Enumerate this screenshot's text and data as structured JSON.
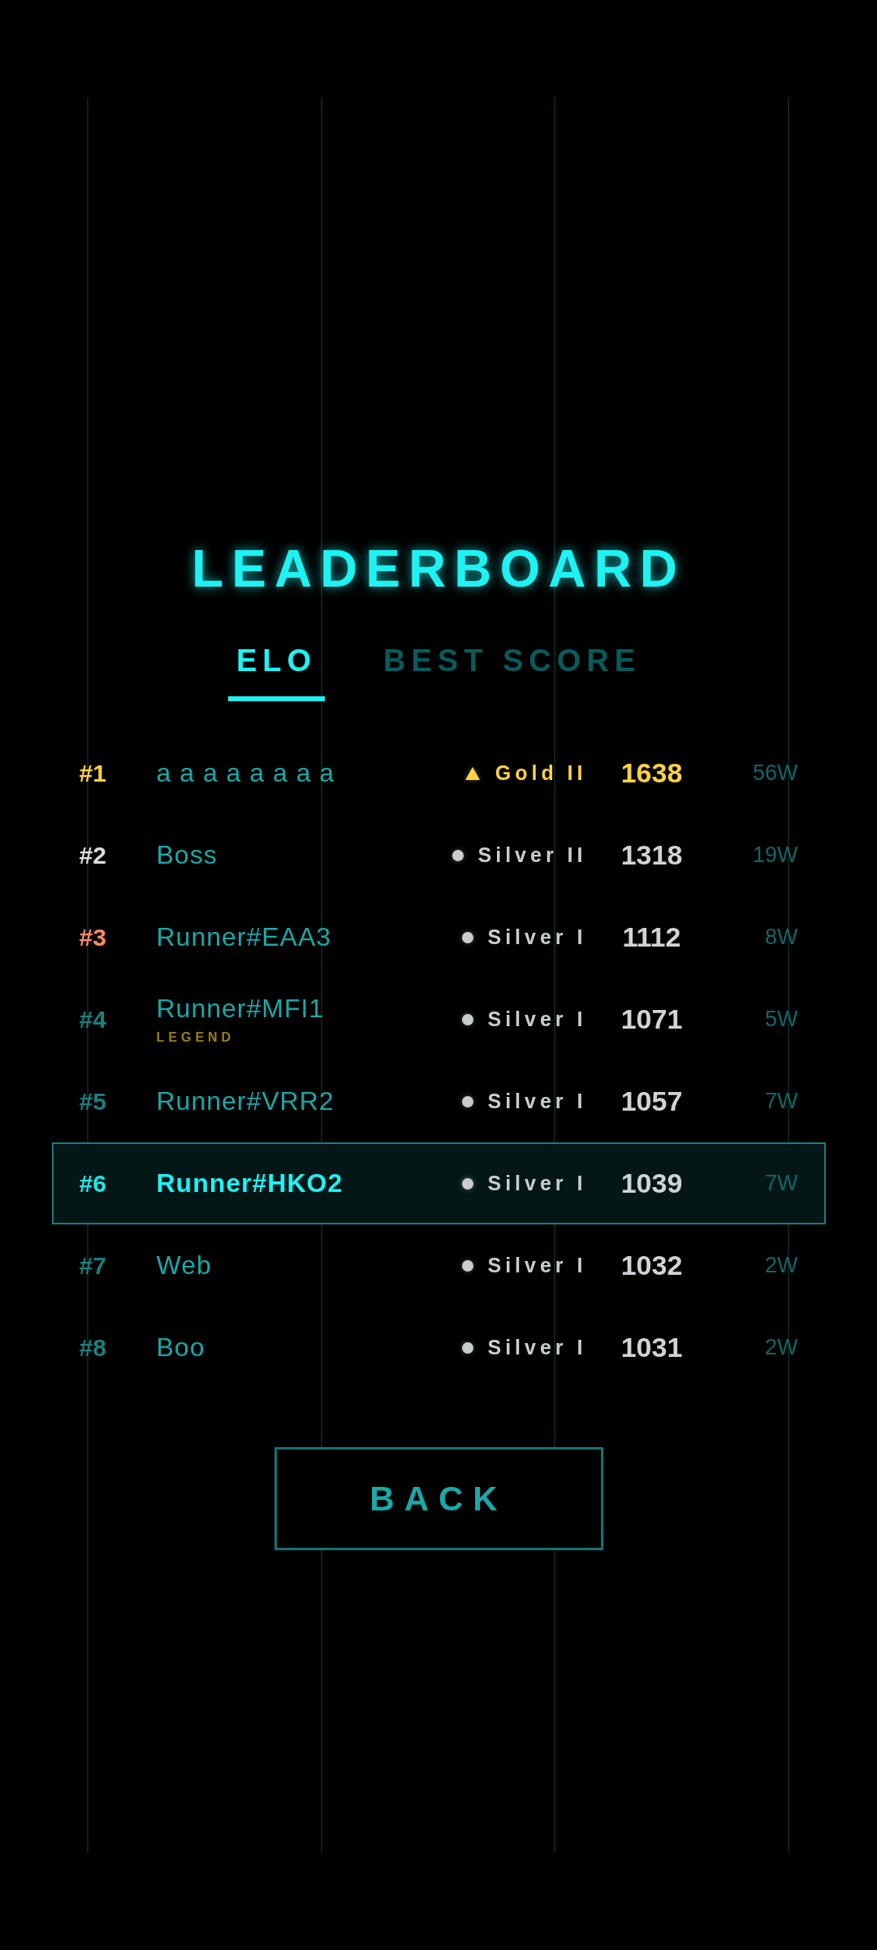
{
  "title": "LEADERBOARD",
  "tabs": [
    {
      "label": "ELO",
      "selected": true
    },
    {
      "label": "BEST SCORE",
      "selected": false
    }
  ],
  "rows": [
    {
      "rank": "#1",
      "color": "#ffd23f",
      "name": "a a a a a a a a",
      "tier": {
        "kind": "triangle",
        "label": "Gold II",
        "color": "#ffd23f"
      },
      "elo": "1638",
      "wins": "56W",
      "selected": false
    },
    {
      "rank": "#2",
      "color": "#d8dde0",
      "name": "Boss",
      "tier": {
        "kind": "dot",
        "label": "Silver II",
        "color": "#c8cdd0"
      },
      "elo": "1318",
      "wins": "19W",
      "selected": false
    },
    {
      "rank": "#3",
      "color": "#ff8a6a",
      "name": "Runner#EAA3",
      "tier": {
        "kind": "dot",
        "label": "Silver I",
        "color": "#c8cdd0"
      },
      "elo": "1112",
      "wins": "8W",
      "selected": false
    },
    {
      "rank": "#4",
      "color": "#1a7f7f",
      "name": "Runner#MFI1",
      "badge": "LEGEND",
      "tier": {
        "kind": "dot",
        "label": "Silver I",
        "color": "#c8cdd0"
      },
      "elo": "1071",
      "wins": "5W",
      "selected": false
    },
    {
      "rank": "#5",
      "color": "#1a7f7f",
      "name": "Runner#VRR2",
      "tier": {
        "kind": "dot",
        "label": "Silver I",
        "color": "#c8cdd0"
      },
      "elo": "1057",
      "wins": "7W",
      "selected": false
    },
    {
      "rank": "#6",
      "color": "#1ee8e8",
      "name": "Runner#HKO2",
      "tier": {
        "kind": "dot",
        "label": "Silver I",
        "color": "#c8cdd0"
      },
      "elo": "1039",
      "wins": "7W",
      "selected": true
    },
    {
      "rank": "#7",
      "color": "#1a7f7f",
      "name": "Web",
      "tier": {
        "kind": "dot",
        "label": "Silver I",
        "color": "#c8cdd0"
      },
      "elo": "1032",
      "wins": "2W",
      "selected": false
    },
    {
      "rank": "#8",
      "color": "#1a7f7f",
      "name": "Boo",
      "tier": {
        "kind": "dot",
        "label": "Silver I",
        "color": "#c8cdd0"
      },
      "elo": "1031",
      "wins": "2W",
      "selected": false
    }
  ],
  "back_button": "BACK"
}
